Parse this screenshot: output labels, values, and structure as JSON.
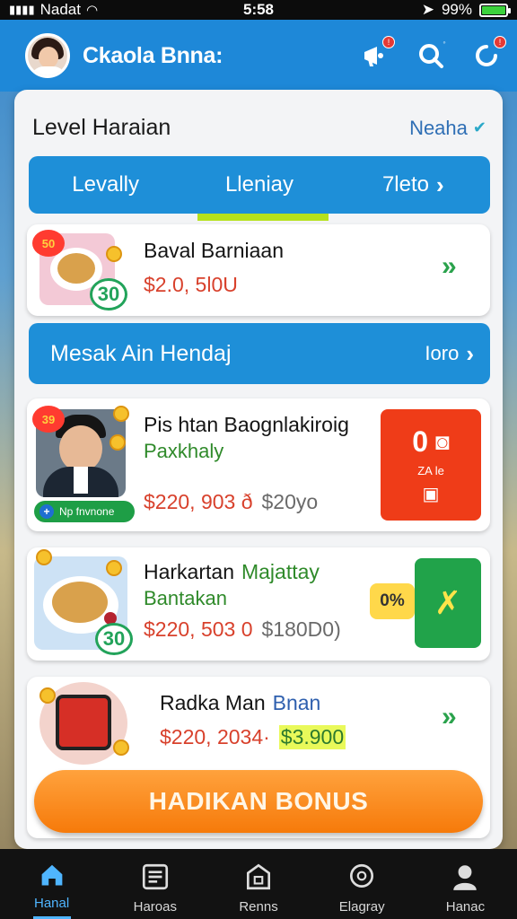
{
  "status_bar": {
    "carrier": "Nadat",
    "time": "5:58",
    "battery": "99%",
    "battery_level": 0.99
  },
  "header": {
    "title": "Ckaola Bnna:",
    "icons": [
      "megaphone-icon",
      "search-icon",
      "refresh-icon"
    ]
  },
  "panel": {
    "title": "Level Haraian",
    "link_label": "Neaha",
    "tabs": [
      "Levally",
      "Lleniay",
      "7leto"
    ],
    "active_tab_index": 1
  },
  "items": [
    {
      "name": "Baval Barniaan",
      "price_main": "$2.0, 5l0U",
      "num_badge": "50",
      "count_badge": "30"
    },
    {
      "name": "Pis htan Baognlakiroig",
      "subtitle": "Paxkhaly",
      "price_main": "$220, 903 ð",
      "price_old": "$20yo",
      "num_badge": "39",
      "tag": "Np fnvnone",
      "side_label_top": "0",
      "side_label_bottom": "ZA le"
    },
    {
      "name_a": "Harkartan",
      "name_b": "Majattay",
      "subtitle": "Bantakan",
      "price_main": "$220, 503 0",
      "price_old": "$180D0)",
      "count_badge": "30",
      "percent": "0%"
    },
    {
      "name_a": "Radka Man",
      "name_b": "Bnan",
      "price_main": "$220, 2034·",
      "price_hl": "$3.900"
    }
  ],
  "section_bar": {
    "label": "Mesak Ain Hendaj",
    "action": "Ioro"
  },
  "cta_label": "HADIKAN BONUS",
  "bottom_nav": [
    {
      "label": "Hanal",
      "icon": "home-icon",
      "active": true
    },
    {
      "label": "Haroas",
      "icon": "list-icon",
      "active": false
    },
    {
      "label": "Renns",
      "icon": "store-icon",
      "active": false
    },
    {
      "label": "Elagray",
      "icon": "chat-icon",
      "active": false
    },
    {
      "label": "Hanac",
      "icon": "profile-icon",
      "active": false
    }
  ],
  "colors": {
    "brand_blue": "#1e8fd8",
    "cta_orange": "#f67a0a",
    "accent_green": "#2aa24c",
    "accent_red": "#d8412c"
  }
}
